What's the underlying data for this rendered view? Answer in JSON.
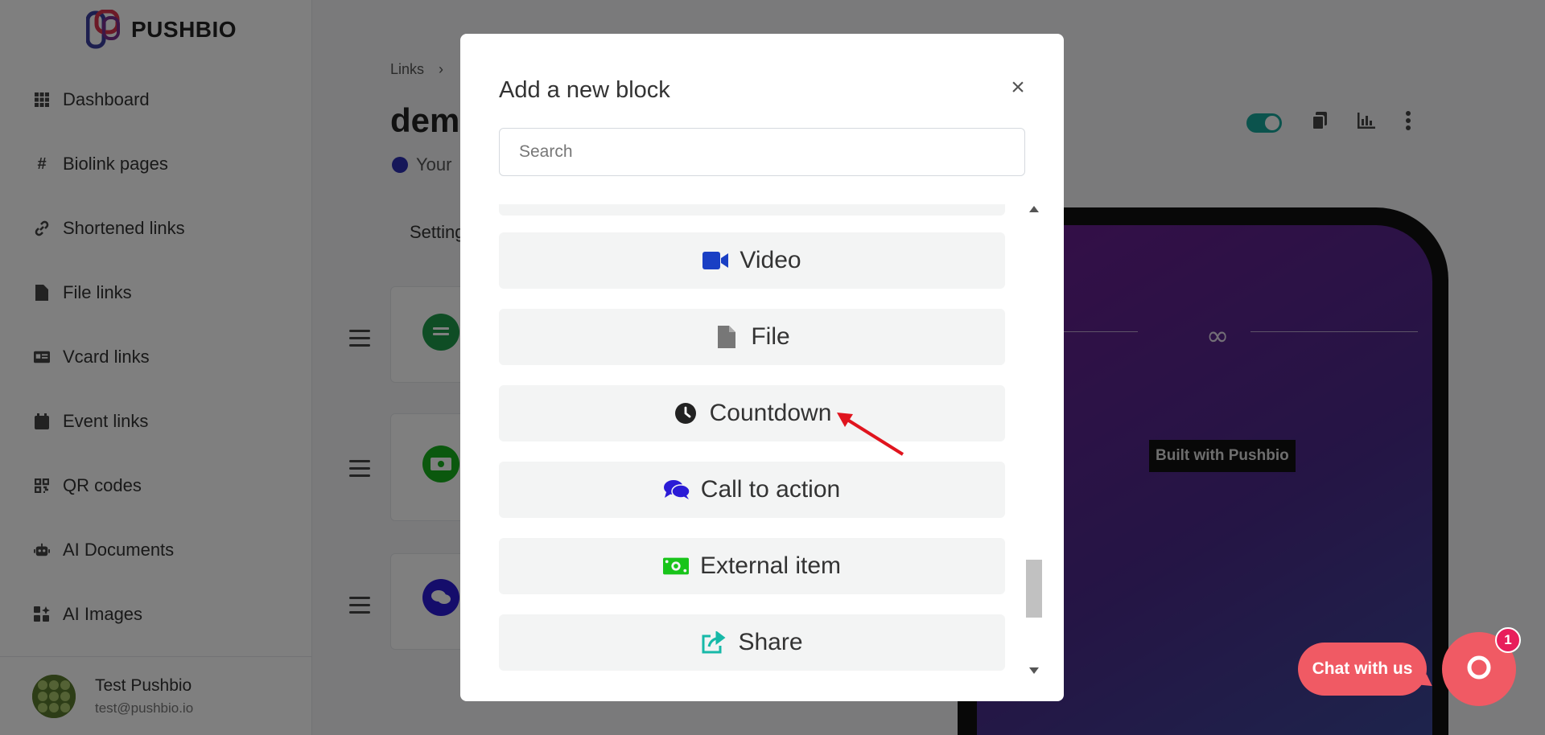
{
  "brand": {
    "name": "PUSHBIO"
  },
  "sidebar": {
    "items": [
      {
        "label": "Dashboard",
        "icon": "grid-icon"
      },
      {
        "label": "Biolink pages",
        "icon": "hash-icon"
      },
      {
        "label": "Shortened links",
        "icon": "link-icon"
      },
      {
        "label": "File links",
        "icon": "file-icon"
      },
      {
        "label": "Vcard links",
        "icon": "id-card-icon"
      },
      {
        "label": "Event links",
        "icon": "calendar-icon"
      },
      {
        "label": "QR codes",
        "icon": "qrcode-icon"
      },
      {
        "label": "AI Documents",
        "icon": "robot-icon"
      },
      {
        "label": "AI Images",
        "icon": "ai-images-icon"
      }
    ]
  },
  "user": {
    "name": "Test Pushbio",
    "email": "test@pushbio.io"
  },
  "main": {
    "breadcrumb": "Links",
    "title": "demo",
    "subtitle": "Your",
    "tab": "Settings"
  },
  "preview": {
    "built_with": "Built with Pushbio",
    "divider_glyph": "∞"
  },
  "modal": {
    "title": "Add a new block",
    "close": "×",
    "search_placeholder": "Search",
    "blocks": [
      {
        "label": "Video",
        "icon": "video-icon",
        "color": "#1a3fc4"
      },
      {
        "label": "File",
        "icon": "file-icon",
        "color": "#777777"
      },
      {
        "label": "Countdown",
        "icon": "clock-icon",
        "color": "#222222"
      },
      {
        "label": "Call to action",
        "icon": "comments-icon",
        "color": "#2b1bd6"
      },
      {
        "label": "External item",
        "icon": "money-bill-icon",
        "color": "#18c41a"
      },
      {
        "label": "Share",
        "icon": "share-icon",
        "color": "#17b9a8"
      }
    ]
  },
  "chat": {
    "label": "Chat with us",
    "badge": "1"
  },
  "colors": {
    "accent": "#f05a64",
    "toggle": "#17a69a"
  }
}
